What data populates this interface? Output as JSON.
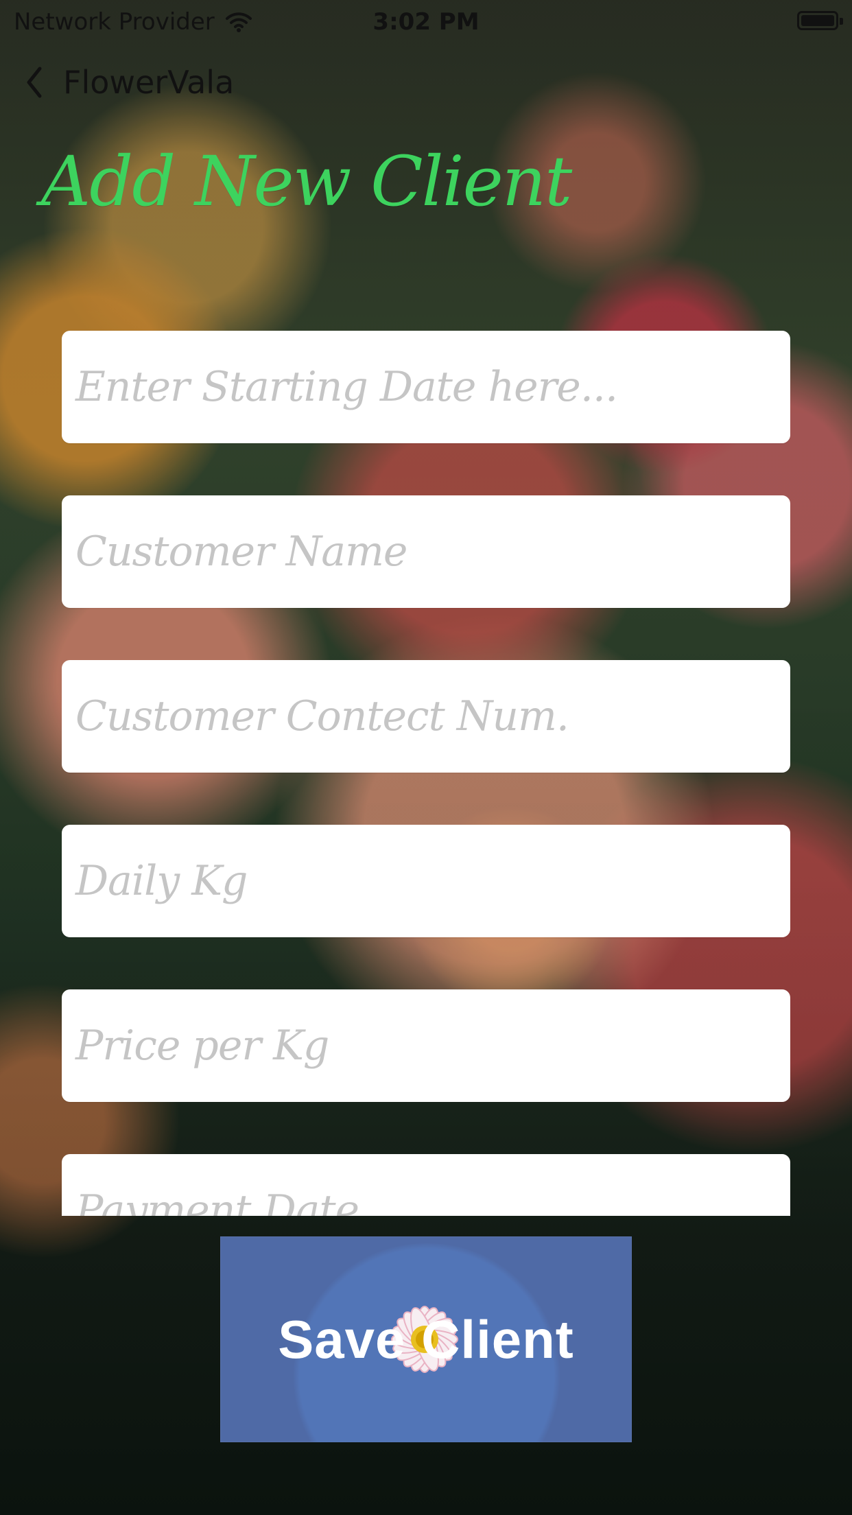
{
  "status_bar": {
    "network": "Network Provider",
    "time": "3:02 PM"
  },
  "nav": {
    "back_title": "FlowerVala"
  },
  "page": {
    "title": "Add New Client"
  },
  "form": {
    "fields": [
      "Enter Starting Date here...",
      "Customer Name",
      "Customer Contect Num.",
      "Daily Kg",
      "Price per Kg",
      "Payment Date"
    ]
  },
  "actions": {
    "save_label": "Save Client"
  },
  "colors": {
    "title": "#3dd35e",
    "field_background": "#ffffff",
    "placeholder": "#c5c5c5",
    "button_background": "#4f6aa6"
  },
  "icons": {
    "wifi": "wifi-icon",
    "battery": "battery-icon",
    "back": "chevron-left-icon",
    "flower": "flower-icon"
  }
}
